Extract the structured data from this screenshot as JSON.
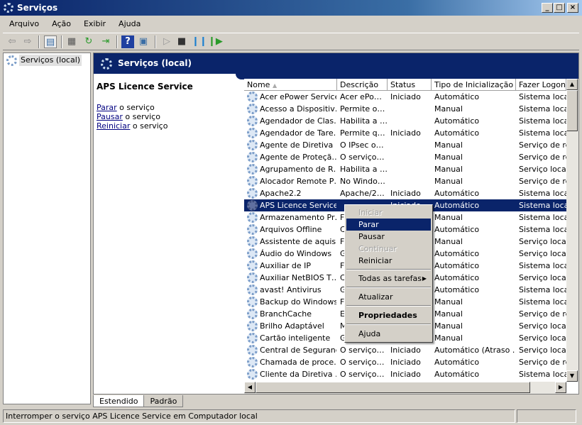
{
  "window": {
    "title": "Serviços",
    "controls": [
      "_",
      "□",
      "×"
    ]
  },
  "menu": [
    "Arquivo",
    "Ação",
    "Exibir",
    "Ajuda"
  ],
  "tree": {
    "item": "Serviços (local)"
  },
  "pane": {
    "header": "Serviços (local)",
    "selected_service": "APS Licence Service",
    "actions": [
      {
        "link": "Parar",
        "rest": " o serviço"
      },
      {
        "link": "Pausar",
        "rest": " o serviço"
      },
      {
        "link": "Reiniciar",
        "rest": " o serviço"
      }
    ]
  },
  "columns": [
    "Nome",
    "Descrição",
    "Status",
    "Tipo de Inicialização",
    "Fazer Logon como"
  ],
  "rows": [
    [
      "Acer ePower Service",
      "Acer ePo…",
      "Iniciado",
      "Automático",
      "Sistema local"
    ],
    [
      "Acesso a Dispositiv…",
      "Permite o…",
      "",
      "Manual",
      "Sistema local"
    ],
    [
      "Agendador de Clas…",
      "Habilita a …",
      "",
      "Automático",
      "Sistema local"
    ],
    [
      "Agendador de Tare…",
      "Permite q…",
      "Iniciado",
      "Automático",
      "Sistema local"
    ],
    [
      "Agente de Diretiva …",
      "O IPsec o…",
      "",
      "Manual",
      "Serviço de rede"
    ],
    [
      "Agente de Proteçã…",
      "O serviço…",
      "",
      "Manual",
      "Serviço de rede"
    ],
    [
      "Agrupamento de R…",
      "Habilita a …",
      "",
      "Manual",
      "Serviço local"
    ],
    [
      "Alocador Remote P…",
      "No Windo…",
      "",
      "Manual",
      "Serviço de rede"
    ],
    [
      "Apache2.2",
      "Apache/2…",
      "Iniciado",
      "Automático",
      "Sistema local"
    ],
    [
      "APS Licence Service",
      "",
      "Iniciado",
      "Automático",
      "Sistema local"
    ],
    [
      "Armazenamento Pr…",
      "F",
      "",
      "Manual",
      "Sistema local"
    ],
    [
      "Arquivos Offline",
      "C",
      "",
      "Automático",
      "Sistema local"
    ],
    [
      "Assistente de aquis…",
      "F",
      "",
      "Manual",
      "Serviço local"
    ],
    [
      "Áudio do Windows",
      "G",
      "",
      "Automático",
      "Serviço local"
    ],
    [
      "Auxiliar de IP",
      "F",
      "",
      "Automático",
      "Sistema local"
    ],
    [
      "Auxiliar NetBIOS T…",
      "C",
      "",
      "Automático",
      "Serviço local"
    ],
    [
      "avast! Antivirus",
      "G",
      "",
      "Automático",
      "Sistema local"
    ],
    [
      "Backup do Windows",
      "F",
      "",
      "Manual",
      "Sistema local"
    ],
    [
      "BranchCache",
      "E",
      "",
      "Manual",
      "Serviço de rede"
    ],
    [
      "Brilho Adaptável",
      "M",
      "",
      "Manual",
      "Serviço local"
    ],
    [
      "Cartão inteligente",
      "G",
      "",
      "Manual",
      "Serviço local"
    ],
    [
      "Central de Segurança",
      "O serviço…",
      "Iniciado",
      "Automático (Atraso …",
      "Serviço local"
    ],
    [
      "Chamada de proce…",
      "O serviço…",
      "Iniciado",
      "Automático",
      "Serviço de rede"
    ],
    [
      "Cliente da Diretiva …",
      "O serviço…",
      "Iniciado",
      "Automático",
      "Sistema local"
    ]
  ],
  "selected_row": 9,
  "context_menu": {
    "items": [
      "Iniciar",
      "Parar",
      "Pausar",
      "Continuar",
      "Reiniciar",
      "Todas as tarefas",
      "Atualizar",
      "Propriedades",
      "Ajuda"
    ],
    "disabled": [
      "Iniciar",
      "Continuar"
    ],
    "highlighted": "Parar",
    "default": "Propriedades"
  },
  "tabs": [
    "Estendido",
    "Padrão"
  ],
  "active_tab": "Estendido",
  "status": "Interromper o serviço APS Licence Service em Computador local",
  "colors": {
    "title": "#0a246a",
    "selection": "#0a246a",
    "chrome": "#d4d0c8"
  }
}
